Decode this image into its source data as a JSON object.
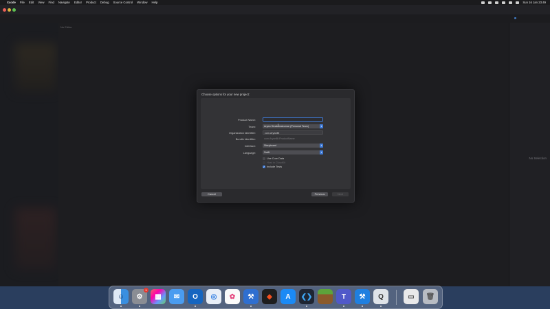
{
  "menubar": {
    "app_name": "Xcode",
    "menus": [
      "File",
      "Edit",
      "View",
      "Find",
      "Navigate",
      "Editor",
      "Product",
      "Debug",
      "Source Control",
      "Window",
      "Help"
    ],
    "clock": "Sun 16 Jan  23:49"
  },
  "editor": {
    "no_editor": "No Editor"
  },
  "inspector": {
    "no_selection": "No Selection"
  },
  "dialog": {
    "title": "Choose options for your new project:",
    "fields": {
      "product_name_label": "Product Name:",
      "product_name_value": "",
      "team_label": "Team:",
      "team_value": "Aryan Sivakamakumar (Personal Team)",
      "org_id_label": "Organization Identifier:",
      "org_id_value": "com.AryanBt",
      "bundle_id_label": "Bundle Identifier:",
      "bundle_id_value": "com.AryanBt.ProductName",
      "interface_label": "Interface:",
      "interface_value": "Storyboard",
      "language_label": "Language:",
      "language_value": "Swift"
    },
    "checkboxes": {
      "core_data": "Use Core Data",
      "cloudkit": "Host in CloudKit",
      "tests": "Include Tests"
    },
    "buttons": {
      "cancel": "Cancel",
      "previous": "Previous",
      "next": "Next"
    }
  },
  "dock": {
    "apps": [
      "finder-icon",
      "system-preferences-icon",
      "launchpad-icon",
      "mail-icon",
      "outlook-icon",
      "safari-icon",
      "photos-icon",
      "xcode-app-icon",
      "figma-icon",
      "app-store-icon",
      "vscode-icon",
      "minecraft-icon",
      "teams-icon",
      "xcode-icon",
      "quicktime-icon",
      "document-icon",
      "trash-icon"
    ],
    "badge_count": "1"
  },
  "colors": {
    "accent": "#3f7ad6",
    "window_bg": "#1f1f21",
    "sheet_bg": "#2a2a2d"
  }
}
